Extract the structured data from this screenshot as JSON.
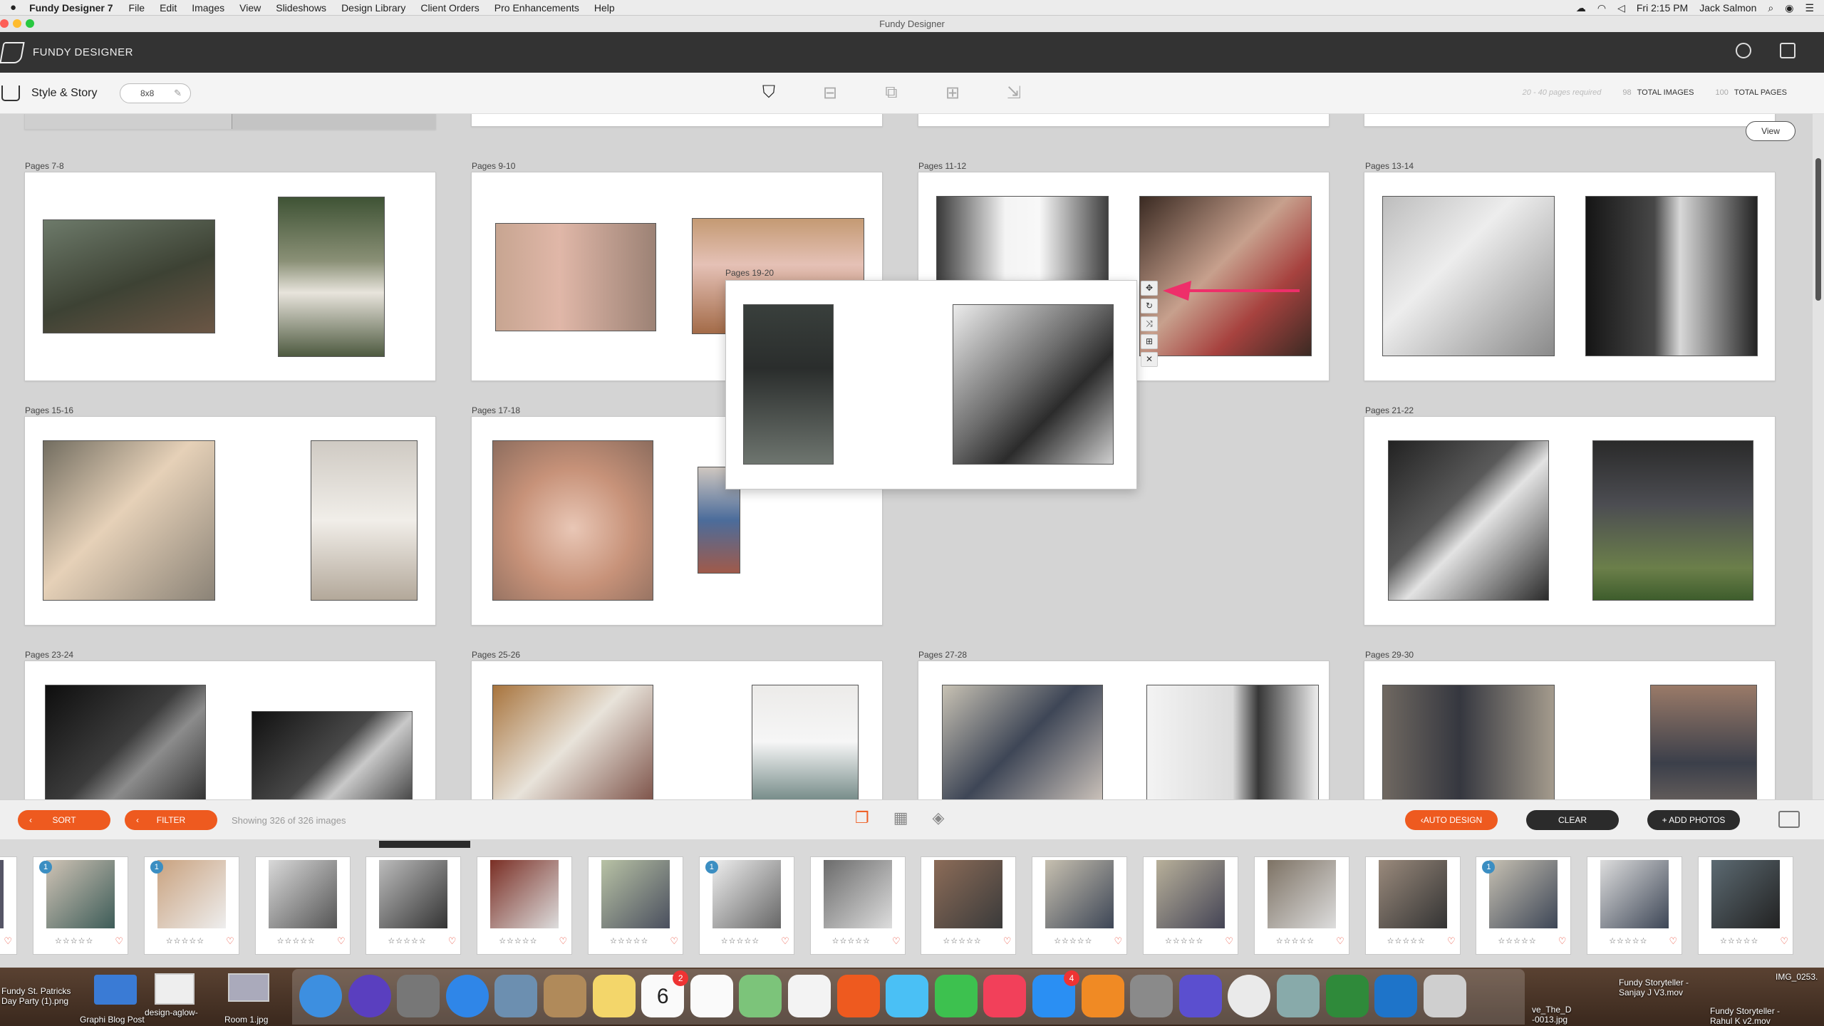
{
  "menubar": {
    "app_name": "Fundy Designer 7",
    "items": [
      "File",
      "Edit",
      "Images",
      "View",
      "Slideshows",
      "Design Library",
      "Client Orders",
      "Pro Enhancements",
      "Help"
    ],
    "clock": "Fri 2:15 PM",
    "user": "Jack Salmon"
  },
  "window": {
    "title": "Fundy Designer"
  },
  "header": {
    "brand": "FUNDY DESIGNER"
  },
  "toolbar": {
    "title": "Style & Story",
    "album_size": "8x8",
    "pages_required": "20 - 40 pages required",
    "total_images_count": "98",
    "total_images_label": "TOTAL IMAGES",
    "total_pages_count": "100",
    "total_pages_label": "TOTAL PAGES"
  },
  "workspace": {
    "view_label": "View",
    "spreads": [
      {
        "label": "Pages 7-8"
      },
      {
        "label": "Pages 9-10"
      },
      {
        "label": "Pages 11-12"
      },
      {
        "label": "Pages 13-14"
      },
      {
        "label": "Pages 15-16"
      },
      {
        "label": "Pages 17-18"
      },
      {
        "label": "Pages 21-22"
      },
      {
        "label": "Pages 23-24"
      },
      {
        "label": "Pages 25-26"
      },
      {
        "label": "Pages 27-28"
      },
      {
        "label": "Pages 29-30"
      }
    ],
    "floating_spread": {
      "label": "Pages 19-20"
    }
  },
  "bottombar": {
    "sort_label": "SORT",
    "filter_label": "FILTER",
    "showing": "Showing 326 of 326 images",
    "auto_design_label": "AUTO DESIGN",
    "clear_label": "CLEAR",
    "add_photos_label": "+ ADD PHOTOS"
  },
  "filmstrip": {
    "stars": "☆☆☆☆☆",
    "heart": "♡",
    "thumbs": [
      {
        "badge": "1"
      },
      {
        "badge": "1"
      },
      {
        "badge": ""
      },
      {
        "badge": ""
      },
      {
        "badge": ""
      },
      {
        "badge": ""
      },
      {
        "badge": "1"
      },
      {
        "badge": ""
      },
      {
        "badge": ""
      },
      {
        "badge": ""
      },
      {
        "badge": ""
      },
      {
        "badge": ""
      },
      {
        "badge": ""
      },
      {
        "badge": "1"
      },
      {
        "badge": ""
      },
      {
        "badge": ""
      }
    ]
  },
  "dock": {
    "desktop_left_1": "Fundy St. Patricks",
    "desktop_left_2": "Day Party (1).png",
    "desktop_label_a": "Graphi Blog Post",
    "desktop_label_b": "design-aglow-",
    "desktop_label_c": "Room 1.jpg",
    "calendar_day": "6",
    "calendar_badge": "2",
    "appstore_badge": "4",
    "right_label_1a": "Fundy Storyteller -",
    "right_label_1b": "Sanjay J V3.mov",
    "right_label_2a": "Fundy Storyteller -",
    "right_label_2b": "Rahul K v2.mov",
    "right_label_3": "ve_The_D",
    "right_label_4": "-0013.jpg",
    "right_label_5": "IMG_0253."
  },
  "colors": {
    "accent": "#ee5a1f",
    "arrow": "#ee2f6a",
    "header": "#333333"
  }
}
